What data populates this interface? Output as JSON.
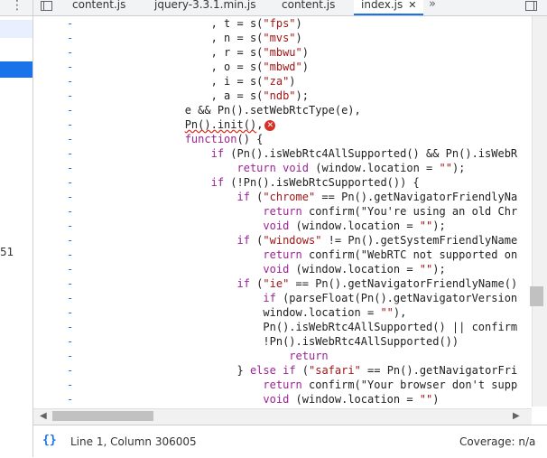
{
  "left_pane": {
    "menu_icon": "⋮",
    "line_number": "51"
  },
  "tabs": [
    {
      "label": "content.js",
      "active": false
    },
    {
      "label": "jquery-3.3.1.min.js",
      "active": false
    },
    {
      "label": "content.js",
      "active": false
    },
    {
      "label": "index.js",
      "active": true
    }
  ],
  "tab_close_glyph": "✕",
  "tab_more_glyph": "»",
  "gutter_marker": "-",
  "code_lines": [
    "                , t = s(\"fps\")",
    "                , n = s(\"mvs\")",
    "                , r = s(\"mbwu\")",
    "                , o = s(\"mbwd\")",
    "                , i = s(\"za\")",
    "                , a = s(\"ndb\");",
    "            e && Pn().setWebRtcType(e),",
    "            Pn().init(),",
    "            function() {",
    "                if (Pn().isWebRtc4AllSupported() && Pn().isWebR",
    "                    return void (window.location = \"\");",
    "                if (!Pn().isWebRtcSupported()) {",
    "                    if (\"chrome\" == Pn().getNavigatorFriendlyNa",
    "                        return confirm(\"You're using an old Chr",
    "                        void (window.location = \"\");",
    "                    if (\"windows\" != Pn().getSystemFriendlyName",
    "                        return confirm(\"WebRTC not supported on",
    "                        void (window.location = \"\");",
    "                    if (\"ie\" == Pn().getNavigatorFriendlyName()",
    "                        if (parseFloat(Pn().getNavigatorVersion",
    "                        window.location = \"\"),",
    "                        Pn().isWebRtc4AllSupported() || confirm",
    "                        !Pn().isWebRtc4AllSupported())",
    "                            return",
    "                    } else if (\"safari\" == Pn().getNavigatorFri",
    "                        return confirm(\"Your browser don't supp",
    "                        void (window.location = \"\")"
  ],
  "error_line_index": 7,
  "status": {
    "position": "Line 1, Column 306005",
    "coverage": "Coverage: n/a",
    "braces_icon": "{}"
  },
  "scroll": {
    "left_arrow": "◀",
    "right_arrow": "▶"
  },
  "colors": {
    "accent": "#1a73e8",
    "keyword": "#9b2393",
    "string": "#a31515",
    "error": "#d93025"
  }
}
